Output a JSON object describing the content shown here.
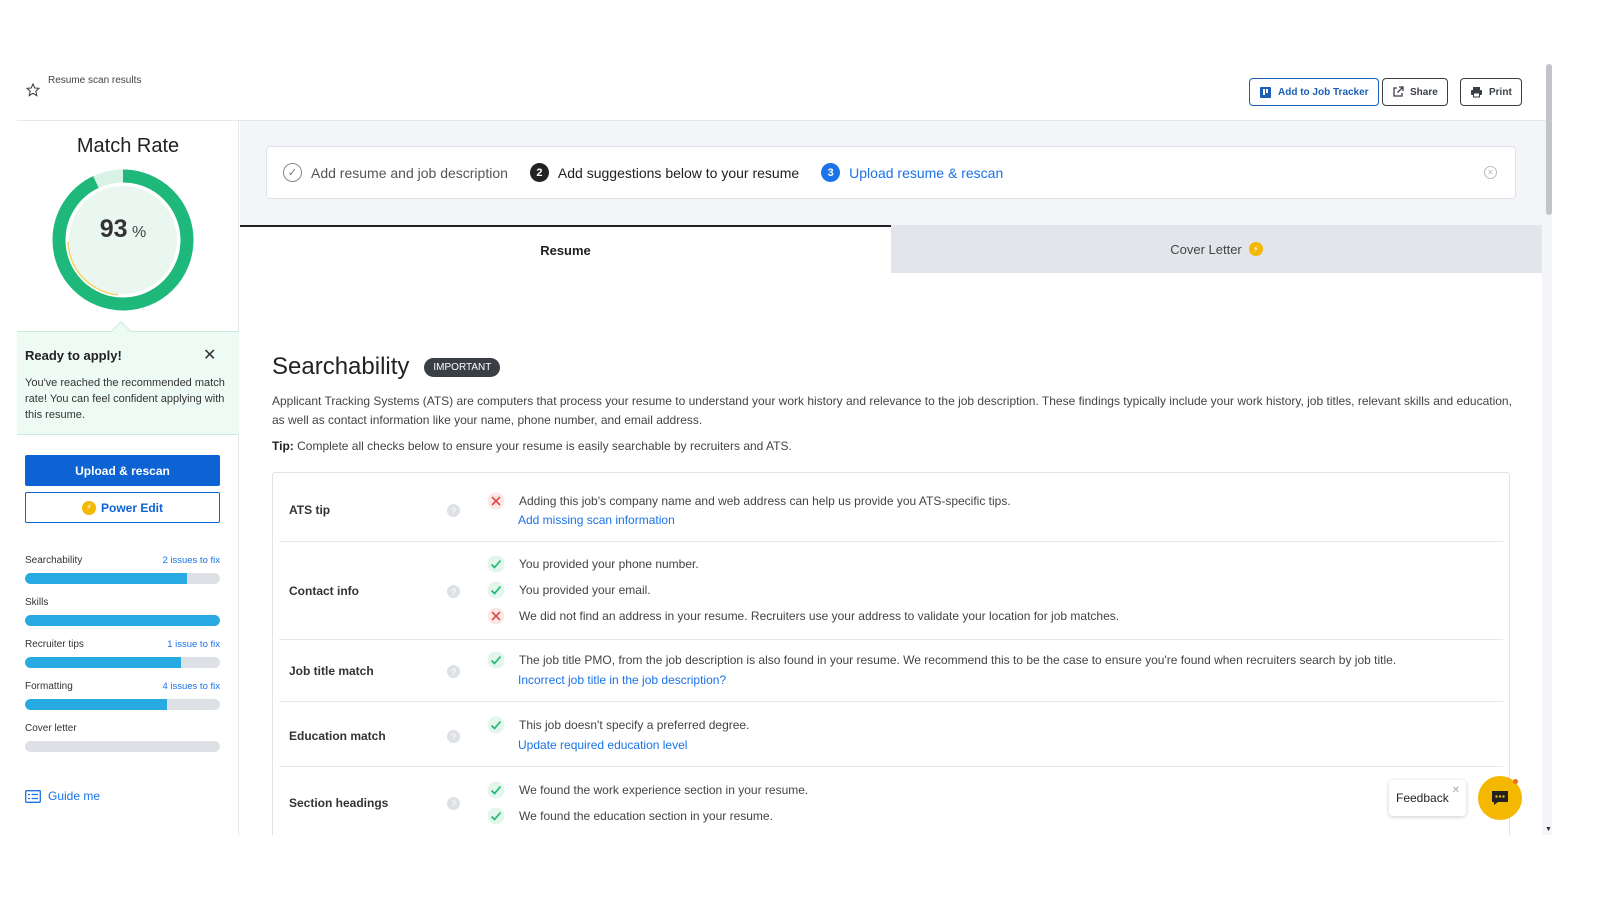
{
  "header": {
    "title": "Resume scan results",
    "add_tracker_label": "Add to Job Tracker",
    "share_label": "Share",
    "print_label": "Print"
  },
  "sidebar": {
    "match_title": "Match Rate",
    "match_value": "93",
    "match_unit": "%",
    "match_fraction": 0.93,
    "ready_title": "Ready to apply!",
    "ready_body": "You've reached the recommended match rate! You can feel confident applying with this resume.",
    "upload_label": "Upload & rescan",
    "power_edit_label": "Power Edit",
    "progress": [
      {
        "label": "Searchability",
        "note": "2 issues to fix",
        "fraction": 0.83
      },
      {
        "label": "Skills",
        "note": "",
        "fraction": 1.0
      },
      {
        "label": "Recruiter tips",
        "note": "1 issue to fix",
        "fraction": 0.8
      },
      {
        "label": "Formatting",
        "note": "4 issues to fix",
        "fraction": 0.73
      },
      {
        "label": "Cover letter",
        "note": "",
        "fraction": 0.0
      }
    ],
    "guide_label": "Guide me"
  },
  "steps": [
    {
      "num": "✓",
      "label": "Add resume and job description"
    },
    {
      "num": "2",
      "label": "Add suggestions below to your resume"
    },
    {
      "num": "3",
      "label": "Upload resume & rescan"
    }
  ],
  "tabs": {
    "resume": "Resume",
    "cover_letter": "Cover Letter"
  },
  "section": {
    "title": "Searchability",
    "badge": "IMPORTANT",
    "description": "Applicant Tracking Systems (ATS) are computers that process your resume to understand your work history and relevance to the job description. These findings typically include your work history, job titles, relevant skills and education, as well as contact information like your name, phone number, and email address.",
    "tip_label": "Tip:",
    "tip_text": " Complete all checks below to ensure your resume is easily searchable by recruiters and ATS."
  },
  "rows": {
    "ats": {
      "label": "ATS tip",
      "text": "Adding this job's company name and web address can help us provide you ATS-specific tips.",
      "link": "Add missing scan information"
    },
    "contact": {
      "label": "Contact info",
      "items": [
        "You provided your phone number.",
        "You provided your email.",
        "We did not find an address in your resume. Recruiters use your address to validate your location for job matches."
      ]
    },
    "job_title": {
      "label": "Job title match",
      "text": "The job title PMO, from the job description is also found in your resume. We recommend this to be the case to ensure you're found when recruiters search by job title.",
      "link": "Incorrect job title in the job description?"
    },
    "education": {
      "label": "Education match",
      "text": "This job doesn't specify a preferred degree.",
      "link": "Update required education level"
    },
    "sections": {
      "label": "Section headings",
      "items": [
        "We found the work experience section in your resume.",
        "We found the education section in your resume."
      ]
    }
  },
  "feedback_label": "Feedback",
  "colors": {
    "accent": "#0d63d3",
    "success": "#1db87a",
    "error": "#e5484d",
    "progress": "#27a9e1"
  }
}
